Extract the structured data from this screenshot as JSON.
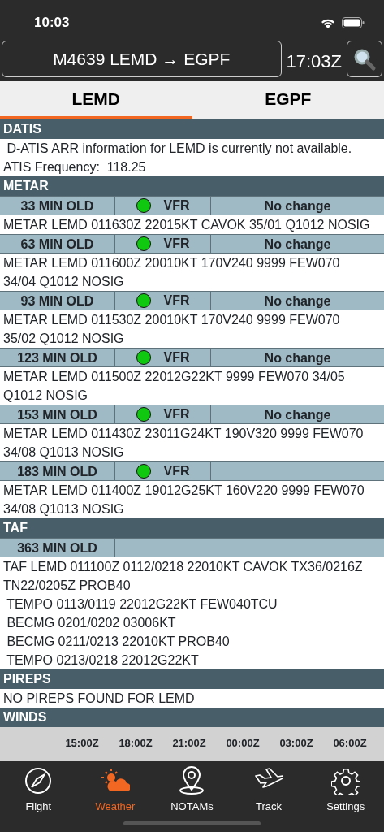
{
  "status_bar": {
    "time": "10:03"
  },
  "header": {
    "flight": "M4639 LEMD → EGPF",
    "clock": "17:03Z"
  },
  "airport_tabs": [
    {
      "label": "LEMD",
      "selected": true
    },
    {
      "label": "EGPF",
      "selected": false
    }
  ],
  "sections": [
    {
      "kind": "text",
      "title": "DATIS",
      "lines": [
        " D-ATIS ARR information for LEMD is currently not available.",
        "ATIS Frequency:  118.25"
      ]
    },
    {
      "kind": "reports",
      "title": "METAR",
      "reports": [
        {
          "age": "33 MIN OLD",
          "category": "VFR",
          "color": "#11c811",
          "change": "No change",
          "lines": [
            "METAR LEMD 011630Z 22015KT CAVOK 35/01 Q1012 NOSIG"
          ]
        },
        {
          "age": "63 MIN OLD",
          "category": "VFR",
          "color": "#11c811",
          "change": "No change",
          "lines": [
            "METAR LEMD 011600Z 20010KT 170V240 9999 FEW070",
            "34/04 Q1012 NOSIG"
          ]
        },
        {
          "age": "93 MIN OLD",
          "category": "VFR",
          "color": "#11c811",
          "change": "No change",
          "lines": [
            "METAR LEMD 011530Z 20010KT 170V240 9999 FEW070",
            "35/02 Q1012 NOSIG"
          ]
        },
        {
          "age": "123 MIN OLD",
          "category": "VFR",
          "color": "#11c811",
          "change": "No change",
          "lines": [
            "METAR LEMD 011500Z 22012G22KT 9999 FEW070 34/05",
            "Q1012 NOSIG"
          ]
        },
        {
          "age": "153 MIN OLD",
          "category": "VFR",
          "color": "#11c811",
          "change": "No change",
          "lines": [
            "METAR LEMD 011430Z 23011G24KT 190V320 9999 FEW070",
            "34/08 Q1013 NOSIG"
          ]
        },
        {
          "age": "183 MIN OLD",
          "category": "VFR",
          "color": "#11c811",
          "lines": [
            "METAR LEMD 011400Z 19012G25KT 160V220 9999 FEW070",
            "34/08 Q1013 NOSIG"
          ]
        }
      ]
    },
    {
      "kind": "reports",
      "title": "TAF",
      "reports": [
        {
          "age": "363 MIN OLD",
          "lines": [
            "TAF LEMD 011100Z 0112/0218 22010KT CAVOK TX36/0216Z",
            "TN22/0205Z PROB40",
            " TEMPO 0113/0119 22012G22KT FEW040TCU",
            " BECMG 0201/0202 03006KT",
            " BECMG 0211/0213 22010KT PROB40",
            " TEMPO 0213/0218 22012G22KT"
          ]
        }
      ]
    },
    {
      "kind": "text",
      "title": "PIREPS",
      "lines": [
        "NO PIREPS FOUND FOR LEMD"
      ]
    },
    {
      "kind": "winds",
      "title": "WINDS",
      "times": [
        "15:00Z",
        "18:00Z",
        "21:00Z",
        "00:00Z",
        "03:00Z",
        "06:00Z"
      ]
    }
  ],
  "tab_bar": [
    {
      "kind": "compass",
      "label": "Flight",
      "selected": false
    },
    {
      "kind": "weather",
      "label": "Weather",
      "selected": true
    },
    {
      "kind": "pin",
      "label": "NOTAMs",
      "selected": false
    },
    {
      "kind": "plane",
      "label": "Track",
      "selected": false
    },
    {
      "kind": "gear",
      "label": "Settings",
      "selected": false
    }
  ]
}
